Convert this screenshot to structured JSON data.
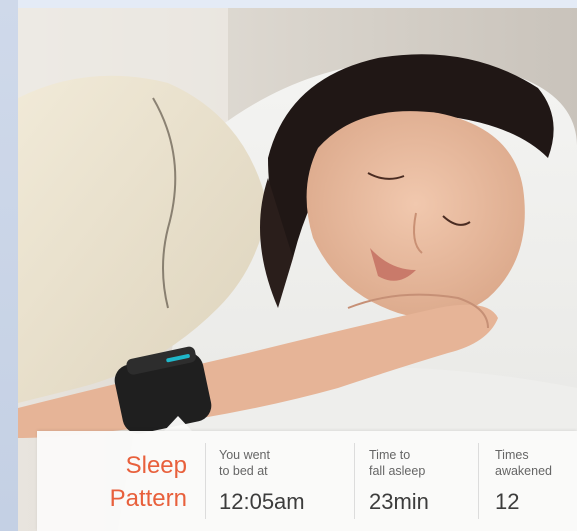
{
  "panel": {
    "title_line1": "Sleep",
    "title_line2": "Pattern"
  },
  "stats": [
    {
      "label_line1": "You went",
      "label_line2": "to bed at",
      "value": "12:05am"
    },
    {
      "label_line1": "Time to",
      "label_line2": "fall asleep",
      "value": "23min"
    },
    {
      "label_line1": "Times",
      "label_line2": "awakened",
      "value": "12"
    }
  ],
  "colors": {
    "accent": "#e8603c",
    "value_text": "#3c3c3c",
    "label_text": "#666666",
    "band_strap": "#1f1f1f",
    "band_light": "#1fb7c9"
  },
  "icons": {
    "wristband": "sleep-tracker-band"
  }
}
